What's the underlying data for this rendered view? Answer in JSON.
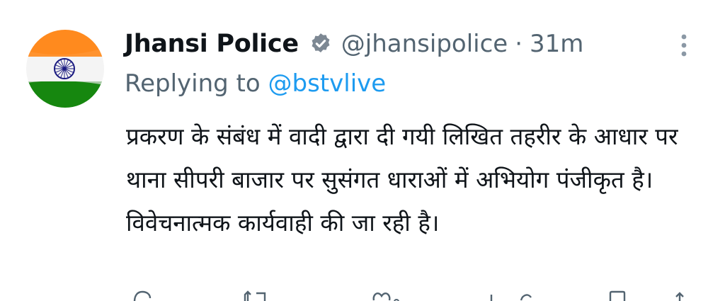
{
  "tweet": {
    "display_name": "Jhansi Police",
    "handle": "@jhansipolice",
    "separator": "·",
    "time": "31m",
    "replying_prefix": "Replying to",
    "replying_to": "@bstvlive",
    "text": "प्रकरण के संबंध में वादी द्वारा दी गयी लिखित तहरीर के आधार पर थाना सीपरी बाजार पर सुसंगत धाराओं में अभियोग पंजीकृत है। विवेचनात्मक कार्यवाही की जा रही है।"
  },
  "icons": {
    "avatar": "india-flag-avatar",
    "verified": "verified-badge-icon",
    "more": "more-vertical-icon",
    "reply": "reply-icon",
    "retweet": "retweet-icon",
    "like": "like-icon",
    "views": "views-icon",
    "bookmark": "bookmark-icon",
    "share": "share-icon"
  },
  "colors": {
    "text": "#0f1419",
    "secondary": "#536471",
    "link": "#1d9bf0",
    "saffron": "#ff9933",
    "green": "#138808",
    "chakra": "#000080"
  }
}
